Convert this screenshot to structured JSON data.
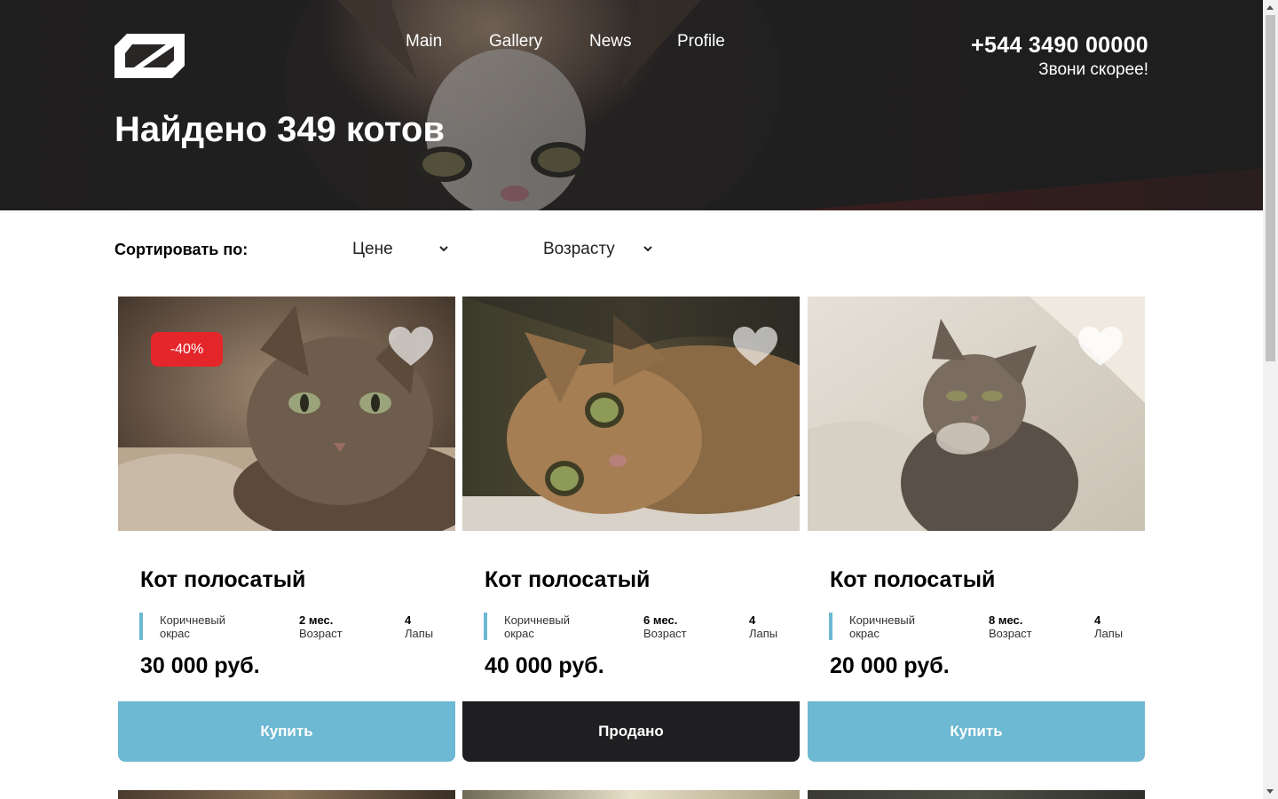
{
  "nav": [
    {
      "label": "Main"
    },
    {
      "label": "Gallery"
    },
    {
      "label": "News"
    },
    {
      "label": "Profile"
    }
  ],
  "contact": {
    "phone": "+544 3490 00000",
    "cta": "Звони скорее!"
  },
  "hero": {
    "title": "Найдено 349 котов"
  },
  "sort": {
    "label": "Сортировать по:",
    "options": [
      {
        "label": "Цене"
      },
      {
        "label": "Возрасту"
      }
    ]
  },
  "cards": [
    {
      "name": "Кот полосатый",
      "badge": "-40%",
      "color_value": "Коричневый",
      "color_label": "окрас",
      "age_value": "2 мес.",
      "age_label": "Возраст",
      "paws_value": "4",
      "paws_label": "Лапы",
      "price": "30 000 руб.",
      "button": "Купить",
      "status": "available"
    },
    {
      "name": "Кот полосатый",
      "badge": "",
      "color_value": "Коричневый",
      "color_label": "окрас",
      "age_value": "6 мес.",
      "age_label": "Возраст",
      "paws_value": "4",
      "paws_label": "Лапы",
      "price": "40 000 руб.",
      "button": "Продано",
      "status": "sold"
    },
    {
      "name": "Кот полосатый",
      "badge": "",
      "color_value": "Коричневый",
      "color_label": "окрас",
      "age_value": "8 мес.",
      "age_label": "Возраст",
      "paws_value": "4",
      "paws_label": "Лапы",
      "price": "20 000 руб.",
      "button": "Купить",
      "status": "available"
    }
  ],
  "colors": {
    "accent": "#6db8d2",
    "sold": "#1f1f21",
    "badge": "#e4262b",
    "hero_bg": "#2a2626"
  },
  "icons": {
    "logo": "brand-logo-icon",
    "heart": "heart-icon",
    "chevron": "chevron-down-icon"
  }
}
